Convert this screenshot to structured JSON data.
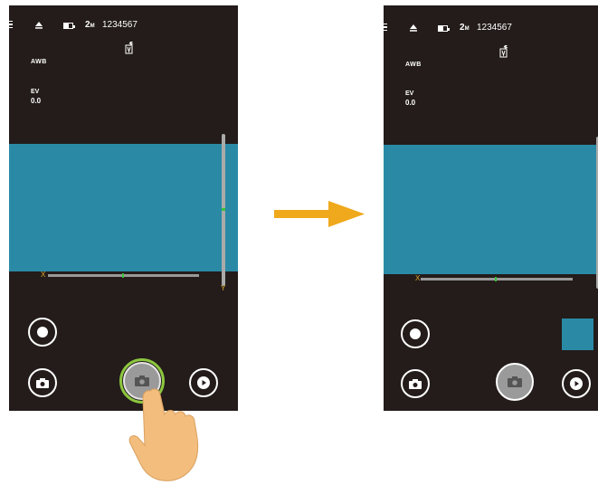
{
  "status": {
    "resolution_main": "2",
    "resolution_unit": "M",
    "shot_count": "1234567"
  },
  "settings": {
    "white_balance": "AWB",
    "ev_label": "EV",
    "ev_value": "0.0"
  },
  "axes": {
    "x_label": "X",
    "y_label": "Y"
  },
  "colors": {
    "screen_bg": "#231c1a",
    "preview": "#2a8aa6",
    "arrow": "#f0a81c",
    "shutter_highlight": "#8cc63f",
    "level_mark": "#39c23a"
  },
  "icons": [
    "menu-icon",
    "eject-icon",
    "battery-icon",
    "flash-icon",
    "shape-icon",
    "camera-icon",
    "play-icon",
    "arrow-right-icon",
    "hand-pointer-icon"
  ]
}
